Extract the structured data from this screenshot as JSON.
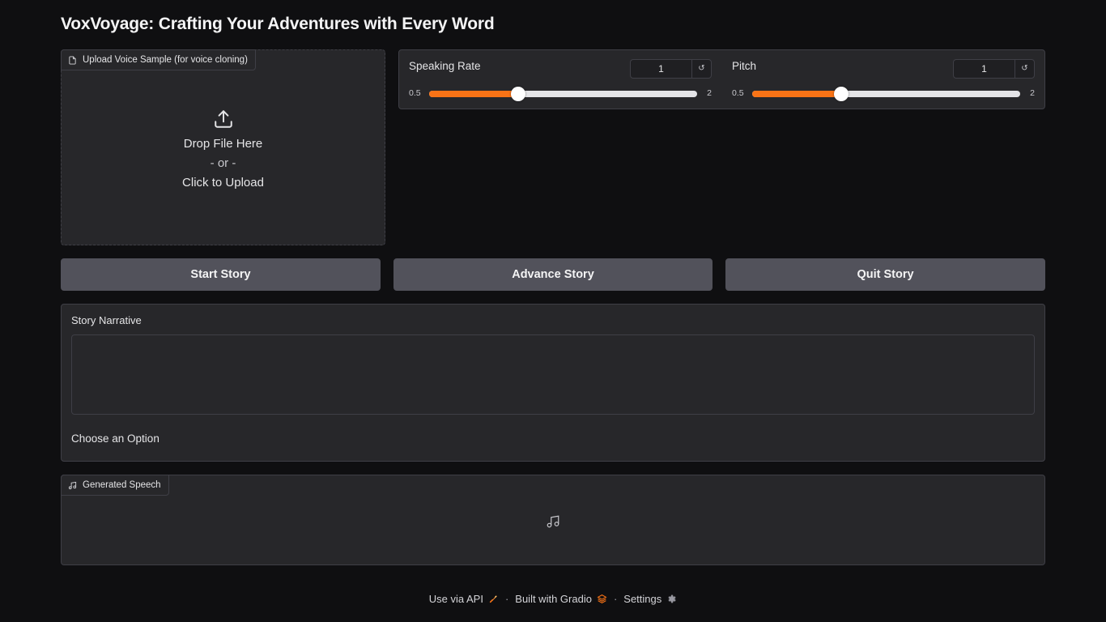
{
  "app": {
    "title": "VoxVoyage: Crafting Your Adventures with Every Word"
  },
  "upload": {
    "label": "Upload Voice Sample (for voice cloning)",
    "drop_text": "Drop File Here",
    "or_text": "- or -",
    "click_text": "Click to Upload"
  },
  "sliders": {
    "speaking_rate": {
      "label": "Speaking Rate",
      "value": "1",
      "min": "0.5",
      "max": "2",
      "fraction": 0.3333
    },
    "pitch": {
      "label": "Pitch",
      "value": "1",
      "min": "0.5",
      "max": "2",
      "fraction": 0.3333
    },
    "reset_glyph": "↺"
  },
  "buttons": {
    "start": "Start Story",
    "advance": "Advance Story",
    "quit": "Quit Story"
  },
  "narrative": {
    "label": "Story Narrative",
    "value": "",
    "choose_label": "Choose an Option"
  },
  "speech": {
    "label": "Generated Speech"
  },
  "footer": {
    "api": "Use via API",
    "built": "Built with Gradio",
    "settings": "Settings",
    "separator": "·"
  },
  "colors": {
    "accent": "#f97316",
    "background": "#0f0f11",
    "panel": "#27272a",
    "button": "#52525b"
  }
}
